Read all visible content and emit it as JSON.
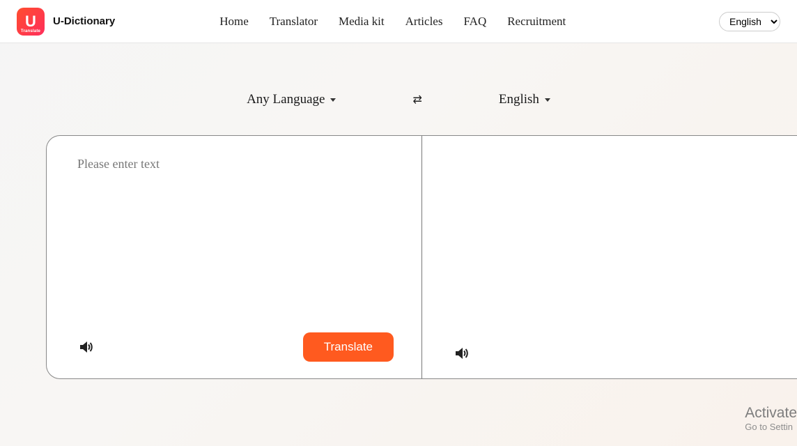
{
  "header": {
    "logo_letter": "U",
    "logo_sub": "Translate",
    "brand": "U-Dictionary",
    "nav": [
      "Home",
      "Translator",
      "Media kit",
      "Articles",
      "FAQ",
      "Recruitment"
    ],
    "site_language": "English"
  },
  "translator": {
    "source_language": "Any Language",
    "target_language": "English",
    "placeholder": "Please enter text",
    "translate_button": "Translate"
  },
  "watermark": {
    "line1": "Activate",
    "line2": "Go to Settin"
  }
}
